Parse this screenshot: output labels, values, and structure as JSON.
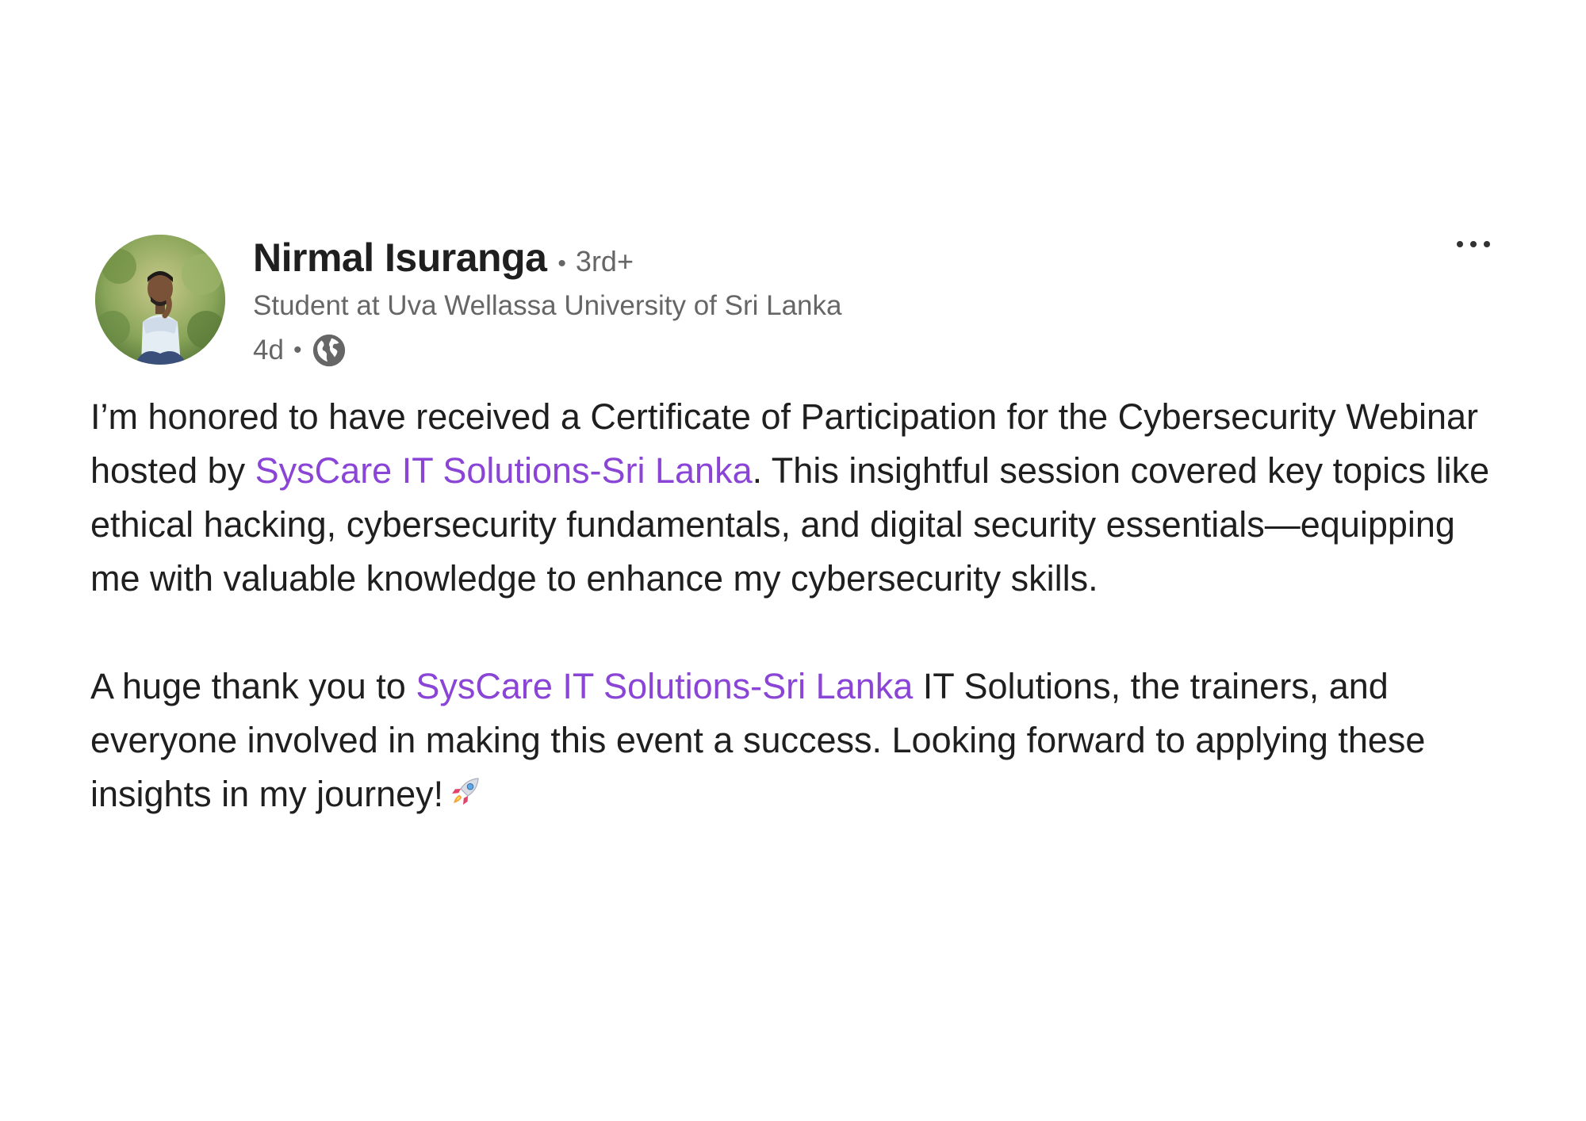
{
  "author": {
    "name": "Nirmal Isuranga",
    "degree": "3rd+",
    "headline": "Student at Uva Wellassa University of Sri Lanka",
    "time": "4d",
    "separator": "•",
    "visibility_icon": "globe-icon",
    "avatar_icon": "profile-photo"
  },
  "menu": {
    "more_icon": "ellipsis-icon"
  },
  "post": {
    "p1_a": "I’m honored to have received a Certificate of Participation for the Cybersecurity Webinar hosted by ",
    "p1_mention": "SysCare IT Solutions-Sri Lanka",
    "p1_b": ". This insightful session covered key topics like ethical hacking, cybersecurity fundamentals, and digital security essentials—equipping me with valuable knowledge to enhance my cybersecurity skills.",
    "p2_a": "A huge thank you to ",
    "p2_mention": "SysCare IT Solutions-Sri Lanka",
    "p2_b": " IT Solutions, the trainers, and everyone involved in making this event a success. Looking forward to applying these insights in my journey!",
    "emoji": "rocket-icon"
  },
  "colors": {
    "mention": "#8a44d6",
    "text": "#1f1f1f",
    "muted": "#666666"
  }
}
